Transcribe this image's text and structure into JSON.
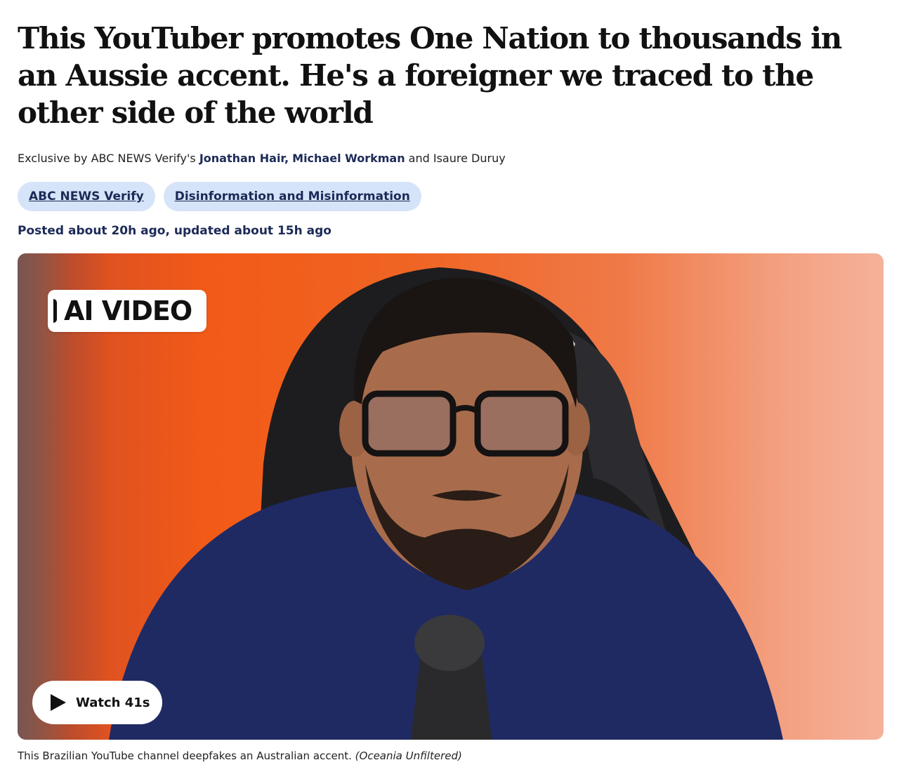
{
  "article": {
    "headline": "This YouTuber promotes One Nation to thousands in an Aussie accent. He's a foreigner we traced to the other side of the world",
    "byline": {
      "prefix": "Exclusive by ABC NEWS Verify's ",
      "author1": "Jonathan Hair,",
      "author2": "Michael Workman",
      "conjunction": " and Isaure Duruy"
    },
    "tags": [
      "ABC NEWS Verify",
      "Disinformation and Misinformation"
    ],
    "dates": "Posted about 20h ago, updated about 15h ago"
  },
  "media": {
    "badge_label": "AI VIDEO",
    "watch_label": "Watch 41s",
    "play_icon": "play-icon",
    "caption_text": "This Brazilian YouTube channel deepfakes an Australian accent. ",
    "caption_credit": "(Oceania Unfiltered)"
  },
  "colors": {
    "link": "#1c2a57",
    "tag_bg": "#d6e4f9",
    "video_bg": "#f25a17"
  }
}
